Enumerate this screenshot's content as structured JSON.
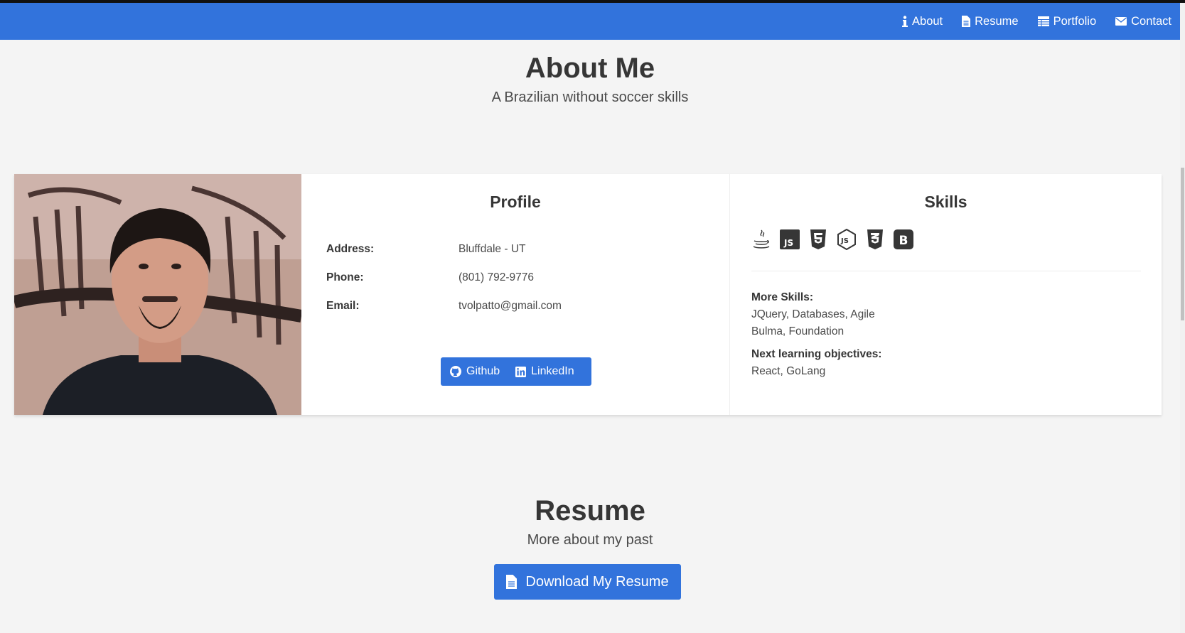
{
  "nav": {
    "items": [
      {
        "label": "About",
        "icon": "info-icon"
      },
      {
        "label": "Resume",
        "icon": "file-icon"
      },
      {
        "label": "Portfolio",
        "icon": "table-icon"
      },
      {
        "label": "Contact",
        "icon": "envelope-icon"
      }
    ]
  },
  "about": {
    "title": "About Me",
    "subtitle": "A Brazilian without soccer skills"
  },
  "profile": {
    "title": "Profile",
    "rows": [
      {
        "label": "Address:",
        "value": "Bluffdale - UT"
      },
      {
        "label": "Phone:",
        "value": "(801) 792-9776"
      },
      {
        "label": "Email:",
        "value": "tvolpatto@gmail.com"
      }
    ],
    "github_label": "Github",
    "linkedin_label": "LinkedIn"
  },
  "skills": {
    "title": "Skills",
    "icons": [
      "java-icon",
      "javascript-icon",
      "html5-icon",
      "nodejs-icon",
      "css3-icon",
      "bootstrap-icon"
    ],
    "more_label": "More Skills:",
    "more_lines": [
      "JQuery, Databases, Agile",
      "Bulma, Foundation"
    ],
    "next_label": "Next learning objectives:",
    "next_value": "React, GoLang"
  },
  "resume": {
    "title": "Resume",
    "subtitle": "More about my past",
    "download_label": "Download My Resume"
  },
  "colors": {
    "accent": "#3273dc",
    "background": "#f4f4f4"
  }
}
